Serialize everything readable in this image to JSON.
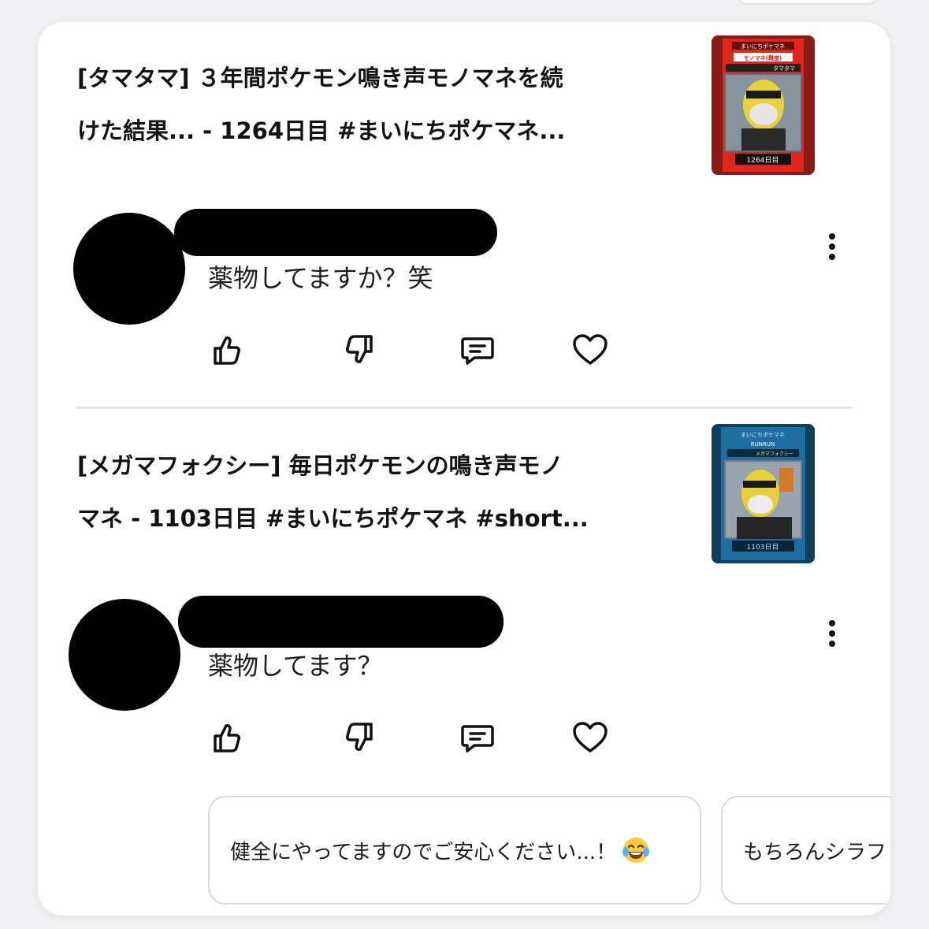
{
  "posts": [
    {
      "video_title_line1": "[タマタマ] ３年間ポケモン鳴き声モノマネを続",
      "video_title_line2": "けた結果... - 1264日目 #まいにちポケマネ...",
      "thumbnail": {
        "icon": "video-thumbnail-red",
        "top_caption": "まいにちポケマネ",
        "banner": "モノマネ(難度)",
        "name_tag": "タマタマ",
        "day_counter": "1264日目",
        "frame_color": "#8a1a14",
        "accent_color": "#e0261c"
      },
      "comment": "薬物してますか？笑"
    },
    {
      "video_title_line1": "[メガマフォクシー] 毎日ポケモンの鳴き声モノ",
      "video_title_line2": "マネ - 1103日目 #まいにちポケマネ #short...",
      "thumbnail": {
        "icon": "video-thumbnail-blue",
        "top_caption": "まいにちポケマネ",
        "banner": "RUNRUN",
        "name_tag": "メガマフォクシー",
        "day_counter": "1103日目",
        "frame_color": "#0f3f5c",
        "accent_color": "#1d6fa0"
      },
      "comment": "薬物してます？"
    }
  ],
  "actions": [
    "like-icon",
    "dislike-icon",
    "reply-icon",
    "heart-icon"
  ],
  "reply_suggestions": [
    {
      "text": "健全にやってますのでご安心ください...！",
      "emoji": "laughing-tears-emoji"
    },
    {
      "text": "もちろんシラフ"
    }
  ]
}
